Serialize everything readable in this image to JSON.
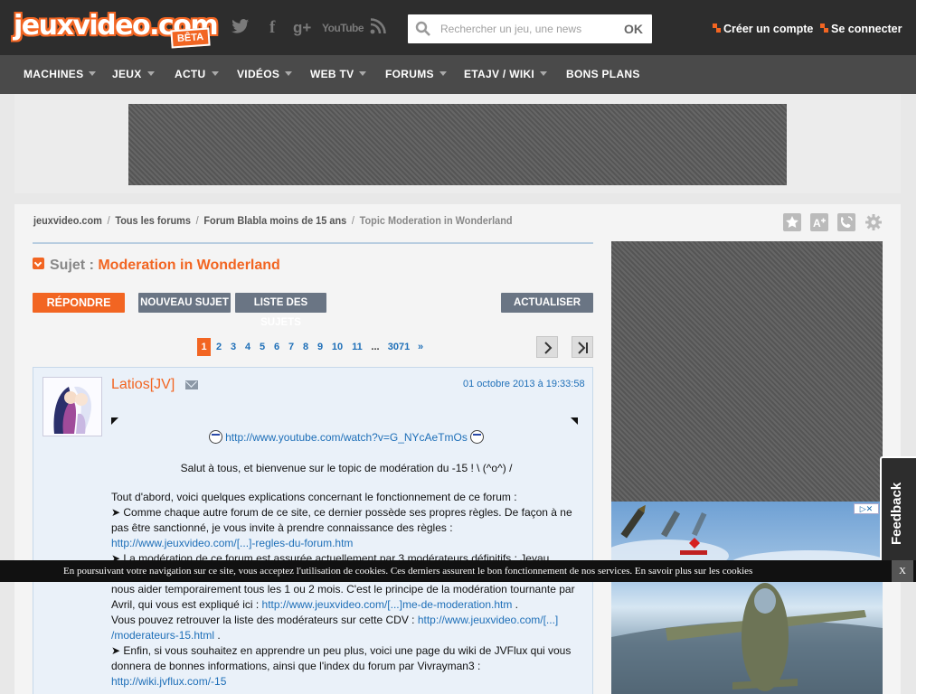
{
  "header": {
    "logo_text": "jeuxvideo.com",
    "logo_badge": "BÊTA",
    "social": [
      "twitter-icon",
      "facebook-icon",
      "google-plus-icon",
      "youtube-icon",
      "rss-icon"
    ],
    "youtube_label": "YouTube",
    "gplus_label": "g+",
    "facebook_label": "f",
    "search": {
      "placeholder": "Rechercher un jeu, une news",
      "button": "OK"
    },
    "create_account": "Créer un compte",
    "login": "Se connecter"
  },
  "nav": {
    "items": [
      {
        "label": "MACHINES",
        "dropdown": true
      },
      {
        "label": "JEUX",
        "dropdown": true
      },
      {
        "label": "ACTU",
        "dropdown": true
      },
      {
        "label": "VIDÉOS",
        "dropdown": true
      },
      {
        "label": "WEB TV",
        "dropdown": true
      },
      {
        "label": "FORUMS",
        "dropdown": true
      },
      {
        "label": "ETAJV / WIKI",
        "dropdown": true
      },
      {
        "label": "BONS PLANS",
        "dropdown": false
      }
    ]
  },
  "breadcrumb": {
    "items": [
      "jeuxvideo.com",
      "Tous les forums",
      "Forum Blabla moins de 15 ans"
    ],
    "current": "Topic Moderation in Wonderland"
  },
  "topic": {
    "label": "Sujet :",
    "title": "Moderation in Wonderland"
  },
  "actions": {
    "reply": "RÉPONDRE",
    "new_topic": "NOUVEAU SUJET",
    "topic_list": "LISTE DES SUJETS",
    "refresh": "ACTUALISER"
  },
  "pagination": {
    "current": "1",
    "pages": [
      "2",
      "3",
      "4",
      "5",
      "6",
      "7",
      "8",
      "9",
      "10",
      "11"
    ],
    "ellipsis": "...",
    "last": "3071",
    "next": "»"
  },
  "post": {
    "author": "Latios[JV]",
    "date": "01 octobre 2013 à 19:33:58",
    "youtube_link": "http://www.youtube.com/watch?v=G_NYcAeTmOs",
    "greeting": "Salut à tous, et bienvenue sur le topic de modération du -15 ! \\ (^o^) /",
    "intro": "Tout d'abord, voici quelques explications concernant le fonctionnement de ce forum :",
    "p1": "➤ Comme chaque autre forum de ce site, ce dernier possède ses propres règles. De façon à ne pas être sanctionné, je vous invite à prendre connaissance des règles :",
    "link_rules": "http://www.jeuxvideo.com/[...]-regles-du-forum.htm",
    "p2_start": "➤ La modération de ce forum est assurée actuellement par 3 modérateurs définitifs : Jeyau,",
    "p2_cont": "nous aider temporairement tous les 1 ou 2 mois. C'est le principe de la modération tournante par Avril, qui vous est expliqué ici :",
    "link_rotation": "http://www.jeuxvideo.com/[...]me-de-moderation.htm",
    "p3": "Vous pouvez retrouver la liste des modérateurs sur cette CDV :",
    "link_mods_1": "http://www.jeuxvideo.com/[...]",
    "link_mods_2": "/moderateurs-15.html",
    "p4": "➤ Enfin, si vous souhaitez en apprendre un peu plus, voici une page du wiki de JVFlux qui vous donnera de bonnes informations, ainsi que l'index du forum par Vivrayman3 :",
    "link_wiki": "http://wiki.jvflux.com/-15",
    "period": "."
  },
  "cookie_bar": {
    "text": "En poursuivant votre navigation sur ce site, vous acceptez l'utilisation de cookies. Ces derniers assurent le bon fonctionnement de nos services. En savoir plus sur les cookies",
    "close": "X"
  },
  "feedback": "Feedback",
  "ad": {
    "adchoices": "▷✕"
  },
  "colors": {
    "accent": "#f26522",
    "link": "#1e6fb8",
    "header_bg": "#2d2d2d",
    "nav_bg": "#4a4a4a",
    "post_bg": "#eaf1f9"
  }
}
